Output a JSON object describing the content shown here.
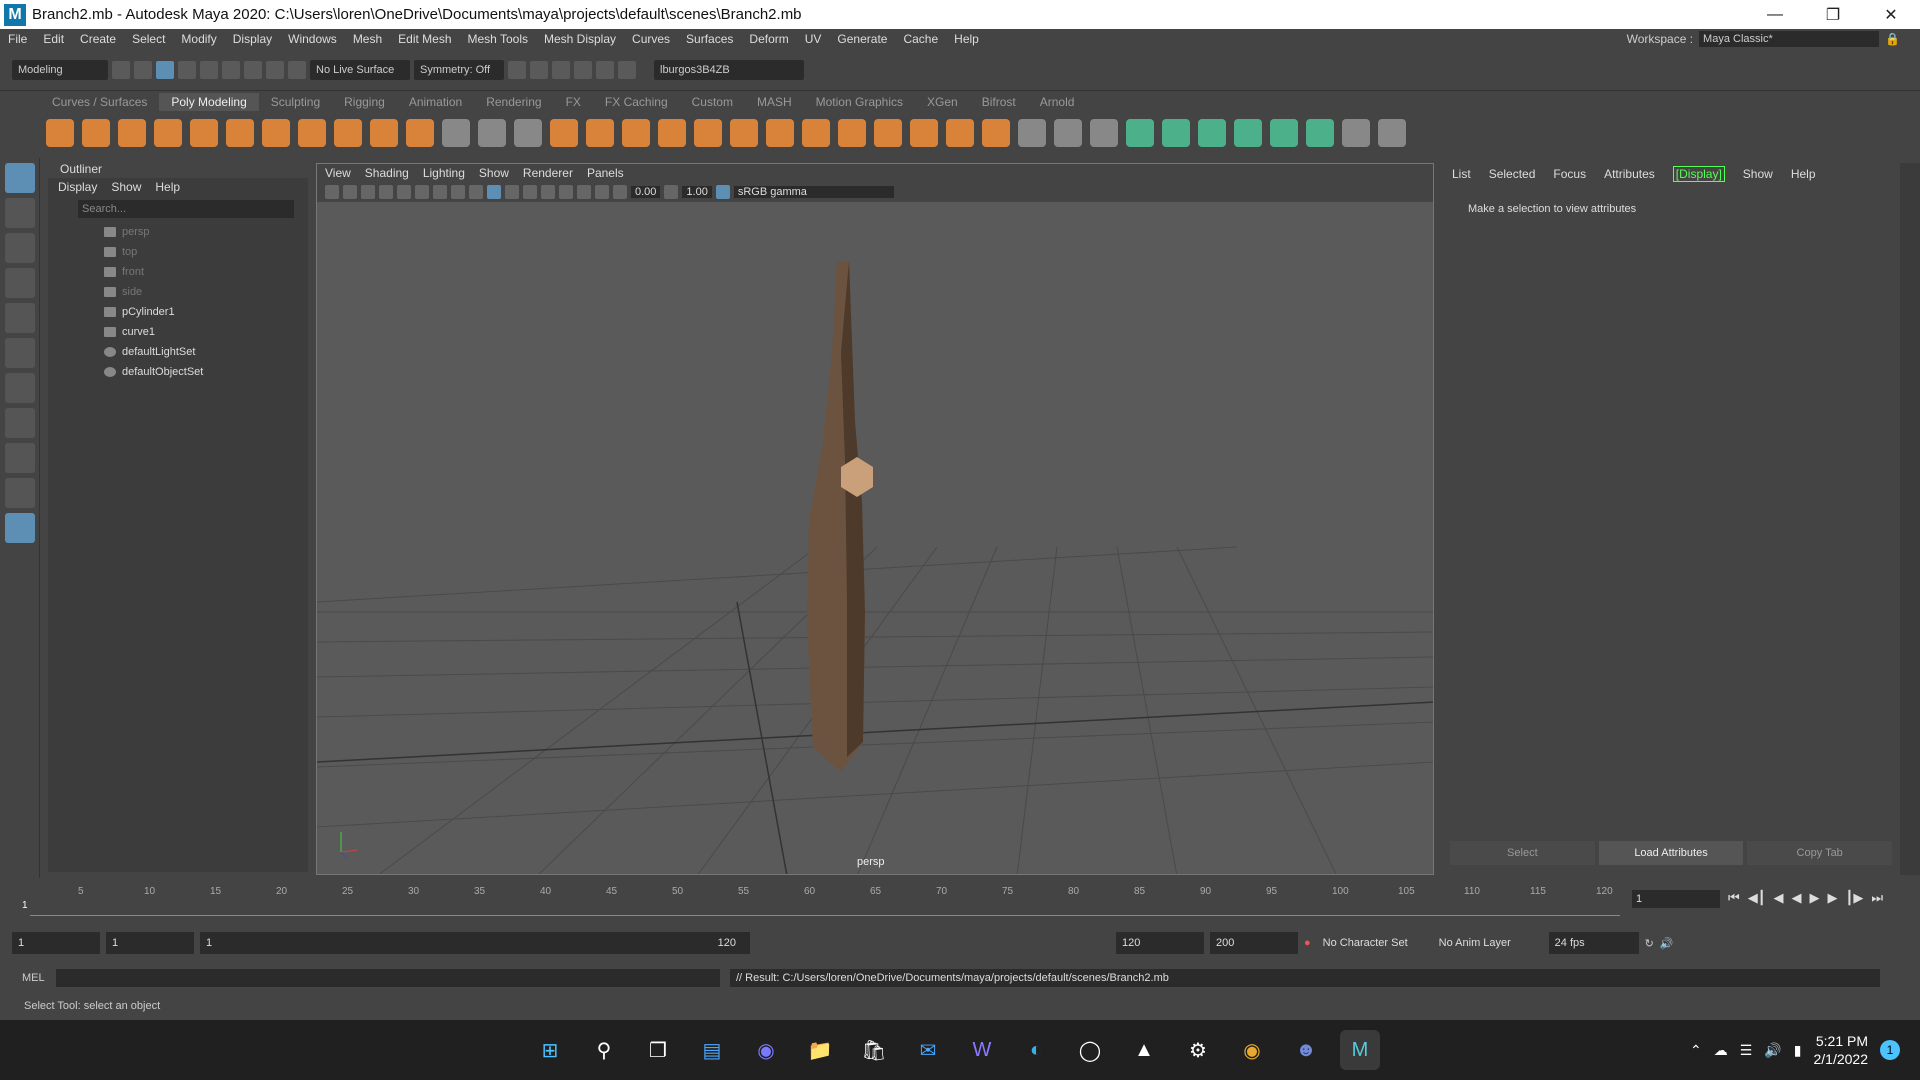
{
  "window": {
    "title": "Branch2.mb - Autodesk Maya 2020: C:\\Users\\loren\\OneDrive\\Documents\\maya\\projects\\default\\scenes\\Branch2.mb",
    "logo": "M"
  },
  "menubar": {
    "items": [
      "File",
      "Edit",
      "Create",
      "Select",
      "Modify",
      "Display",
      "Windows",
      "Mesh",
      "Edit Mesh",
      "Mesh Tools",
      "Mesh Display",
      "Curves",
      "Surfaces",
      "Deform",
      "UV",
      "Generate",
      "Cache",
      "Help"
    ]
  },
  "workspace": {
    "label": "Workspace :",
    "value": "Maya Classic*"
  },
  "statusline": {
    "menuset": "Modeling",
    "live_surface": "No Live Surface",
    "symmetry": "Symmetry: Off",
    "user": "lburgos3B4ZB"
  },
  "shelf": {
    "tabs": [
      "Curves / Surfaces",
      "Poly Modeling",
      "Sculpting",
      "Rigging",
      "Animation",
      "Rendering",
      "FX",
      "FX Caching",
      "Custom",
      "MASH",
      "Motion Graphics",
      "XGen",
      "Bifrost",
      "Arnold"
    ],
    "active": "Poly Modeling"
  },
  "outliner": {
    "title": "Outliner",
    "menu": [
      "Display",
      "Show",
      "Help"
    ],
    "search_placeholder": "Search...",
    "items": [
      {
        "label": "persp",
        "dim": true
      },
      {
        "label": "top",
        "dim": true
      },
      {
        "label": "front",
        "dim": true
      },
      {
        "label": "side",
        "dim": true
      },
      {
        "label": "pCylinder1",
        "dim": false
      },
      {
        "label": "curve1",
        "dim": false
      },
      {
        "label": "defaultLightSet",
        "dim": false
      },
      {
        "label": "defaultObjectSet",
        "dim": false
      }
    ]
  },
  "viewport": {
    "menu": [
      "View",
      "Shading",
      "Lighting",
      "Show",
      "Renderer",
      "Panels"
    ],
    "exposure": "0.00",
    "gamma": "1.00",
    "colorspace": "sRGB gamma",
    "camera": "persp"
  },
  "attribute_editor": {
    "menu": [
      "List",
      "Selected",
      "Focus",
      "Attributes",
      "Show",
      "Help"
    ],
    "display_tab": "[Display]",
    "message": "Make a selection to view attributes",
    "buttons": [
      "Select",
      "Load Attributes",
      "Copy Tab"
    ]
  },
  "timeline": {
    "ticks": [
      "5",
      "10",
      "15",
      "20",
      "25",
      "30",
      "35",
      "40",
      "45",
      "50",
      "55",
      "60",
      "65",
      "70",
      "75",
      "80",
      "85",
      "90",
      "95",
      "100",
      "105",
      "110",
      "115",
      "120"
    ],
    "current_frame": "1"
  },
  "range": {
    "start": "1",
    "playback_start": "1",
    "slider_start": "1",
    "slider_end": "120",
    "playback_end": "120",
    "end": "200",
    "character_set": "No Character Set",
    "anim_layer": "No Anim Layer",
    "fps": "24 fps"
  },
  "command": {
    "lang": "MEL",
    "result": "// Result: C:/Users/loren/OneDrive/Documents/maya/projects/default/scenes/Branch2.mb"
  },
  "helpline": "Select Tool: select an object",
  "taskbar": {
    "time": "5:21 PM",
    "date": "2/1/2022",
    "notification_count": "1"
  }
}
